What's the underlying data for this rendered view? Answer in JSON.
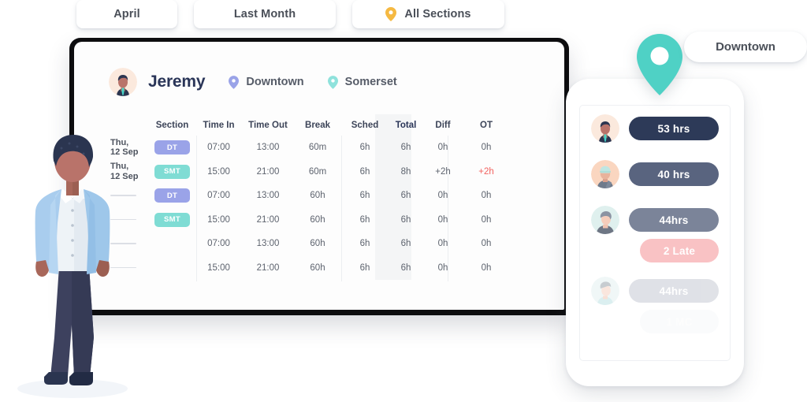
{
  "filters": [
    {
      "label": "April",
      "icon": null
    },
    {
      "label": "Last Month",
      "icon": null
    },
    {
      "label": "All Sections",
      "icon": "map-pin-icon"
    }
  ],
  "dashboard": {
    "user_name": "Jeremy",
    "locations": [
      {
        "label": "Downtown",
        "pin_color": "#9aa3e8"
      },
      {
        "label": "Somerset",
        "pin_color": "#7fdcd4"
      }
    ],
    "table": {
      "columns": [
        "",
        "Section",
        "Time In",
        "Time Out",
        "Break",
        "Sched",
        "Total",
        "Diff",
        "OT"
      ],
      "highlight_column": "Total",
      "rows": [
        {
          "date": "Thu, 12 Sep",
          "date_masked": false,
          "section": "DT",
          "section_style": "dt",
          "time_in": "07:00",
          "time_out": "13:00",
          "break": "60m",
          "sched": "6h",
          "total": "6h",
          "diff": "0h",
          "ot": "0h",
          "ot_alert": false
        },
        {
          "date": "Thu, 12 Sep",
          "date_masked": false,
          "section": "SMT",
          "section_style": "smt",
          "time_in": "15:00",
          "time_out": "21:00",
          "break": "60m",
          "sched": "6h",
          "total": "8h",
          "diff": "+2h",
          "ot": "+2h",
          "ot_alert": true
        },
        {
          "date": "",
          "date_masked": true,
          "section": "DT",
          "section_style": "dt",
          "time_in": "07:00",
          "time_out": "13:00",
          "break": "60h",
          "sched": "6h",
          "total": "6h",
          "diff": "0h",
          "ot": "0h",
          "ot_alert": false
        },
        {
          "date": "",
          "date_masked": true,
          "section": "SMT",
          "section_style": "smt",
          "time_in": "15:00",
          "time_out": "21:00",
          "break": "60h",
          "sched": "6h",
          "total": "6h",
          "diff": "0h",
          "ot": "0h",
          "ot_alert": false
        },
        {
          "date": "",
          "date_masked": true,
          "section": "",
          "section_style": "",
          "time_in": "07:00",
          "time_out": "13:00",
          "break": "60h",
          "sched": "6h",
          "total": "6h",
          "diff": "0h",
          "ot": "0h",
          "ot_alert": false
        },
        {
          "date": "",
          "date_masked": true,
          "section": "",
          "section_style": "",
          "time_in": "15:00",
          "time_out": "21:00",
          "break": "60h",
          "sched": "6h",
          "total": "6h",
          "diff": "0h",
          "ot": "0h",
          "ot_alert": false
        }
      ]
    }
  },
  "location_badge": {
    "label": "Downtown"
  },
  "phone": {
    "entries": [
      {
        "chip": "53 hrs",
        "style": "ind0",
        "extra": null,
        "extra_style": null,
        "fade": "none"
      },
      {
        "chip": "40 hrs",
        "style": "ind1",
        "extra": null,
        "extra_style": null,
        "fade": "none"
      },
      {
        "chip": "44hrs",
        "style": "ind2",
        "extra": "2 Late",
        "extra_style": "late",
        "fade": "none"
      },
      {
        "chip": "44hrs",
        "style": "ind3",
        "extra": "1 MC",
        "extra_style": "mc",
        "fade": "fade"
      }
    ]
  },
  "colors": {
    "badge_dt": "#9aa3e8",
    "badge_smt": "#7fdcd4",
    "ot_alert": "#f2625f",
    "chip_dark": "#2d3a58",
    "chip_late": "#f9c2c4",
    "pin_teal": "#4fd1c5",
    "pin_amber": "#f5b942",
    "title": "#2a3558"
  }
}
